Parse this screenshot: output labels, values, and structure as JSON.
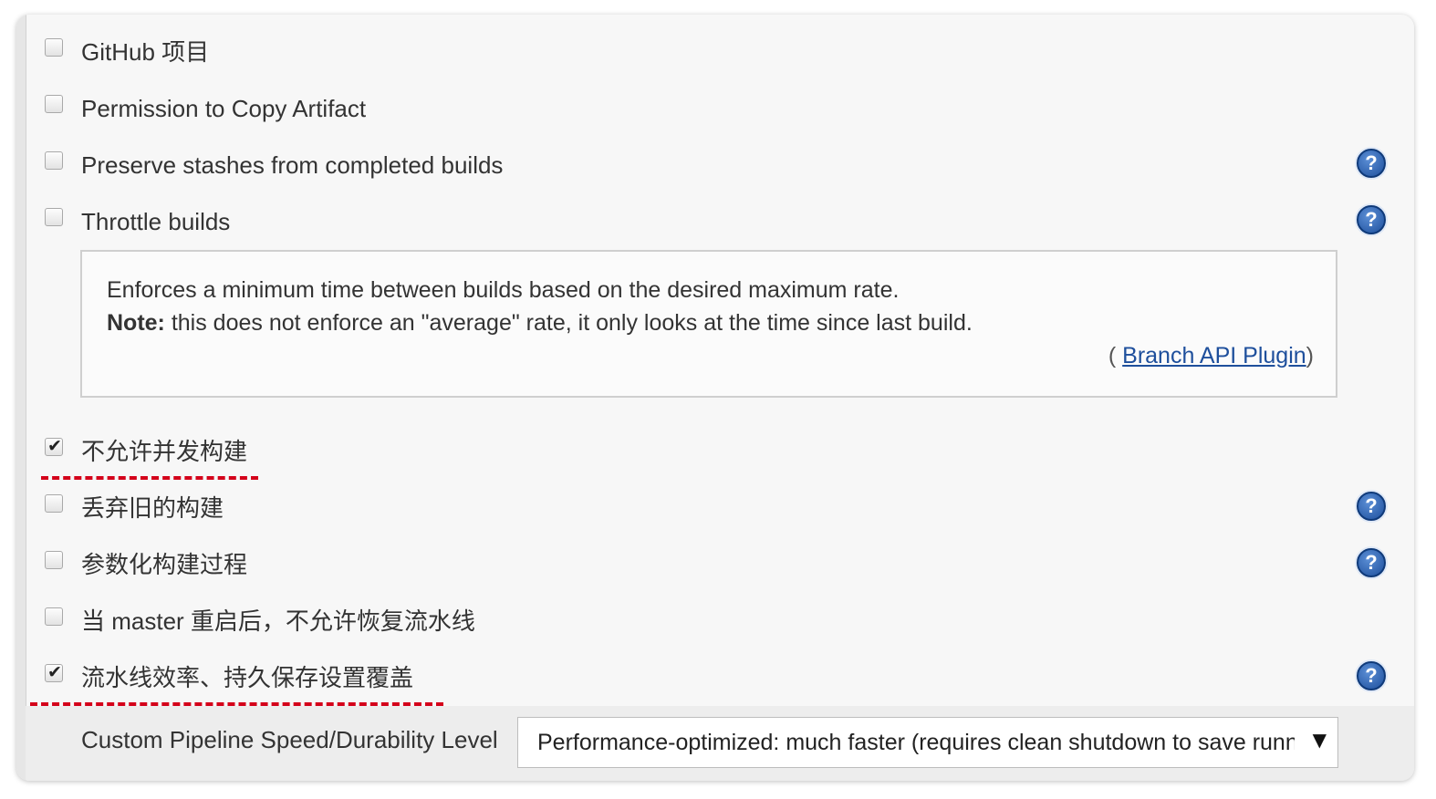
{
  "options": [
    {
      "label": "GitHub 项目",
      "checked": false
    },
    {
      "label": "Permission to Copy Artifact",
      "checked": false
    },
    {
      "label": "Preserve stashes from completed builds",
      "checked": false
    },
    {
      "label": "Throttle builds",
      "checked": false
    },
    {
      "label": "不允许并发构建",
      "checked": true
    },
    {
      "label": "丢弃旧的构建",
      "checked": false
    },
    {
      "label": "参数化构建过程",
      "checked": false
    },
    {
      "label": "当 master 重启后，不允许恢复流水线",
      "checked": false
    },
    {
      "label": "流水线效率、持久保存设置覆盖",
      "checked": true
    }
  ],
  "help": {
    "icon_char": "?",
    "line1": "Enforces a minimum time between builds based on the desired maximum rate.",
    "note_label": "Note:",
    "note_text": " this does not enforce an \"average\" rate, it only looks at the time since last build.",
    "source_open": "( ",
    "source_link": "Branch API Plugin",
    "source_close": ")"
  },
  "durability": {
    "label": "Custom Pipeline Speed/Durability Level",
    "selected": "Performance-optimized: much faster (requires clean shutdown to save running pipelines)",
    "arrow": "▼"
  },
  "colors": {
    "accent_red": "#d4001a",
    "help_blue": "#1d4f9c",
    "link_blue": "#1e4f9c"
  }
}
